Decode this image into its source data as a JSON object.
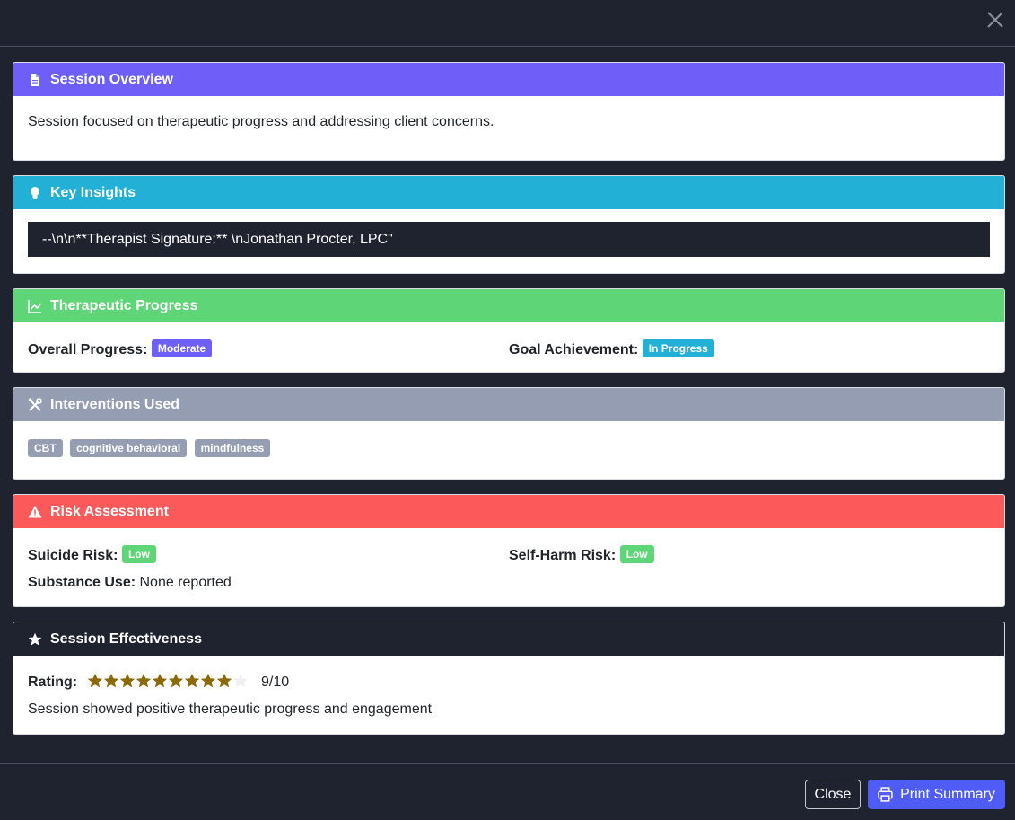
{
  "colors": {
    "background": "#1f2330",
    "purple": "#6e5ff8",
    "cyan": "#22b0d6",
    "green": "#5ed577",
    "gray": "#949db1",
    "red": "#fc5a5a",
    "star_filled": "#8a6a08",
    "button_primary": "#4f5cf5"
  },
  "overview": {
    "title": "Session Overview",
    "icon": "document-icon",
    "text": "Session focused on therapeutic progress and addressing client concerns."
  },
  "insights": {
    "title": "Key Insights",
    "icon": "lightbulb-icon",
    "text": "--\\n\\n**Therapist Signature:** \\nJonathan Procter, LPC\""
  },
  "progress": {
    "title": "Therapeutic Progress",
    "icon": "chart-line-icon",
    "overall_label": "Overall Progress:",
    "overall_value": "Moderate",
    "goal_label": "Goal Achievement:",
    "goal_value": "In Progress"
  },
  "interventions": {
    "title": "Interventions Used",
    "icon": "tools-icon",
    "tags": [
      "CBT",
      "cognitive behavioral",
      "mindfulness"
    ]
  },
  "risk": {
    "title": "Risk Assessment",
    "icon": "warning-icon",
    "suicide_label": "Suicide Risk:",
    "suicide_value": "Low",
    "selfharm_label": "Self-Harm Risk:",
    "selfharm_value": "Low",
    "substance_label": "Substance Use:",
    "substance_value": "None reported"
  },
  "effectiveness": {
    "title": "Session Effectiveness",
    "icon": "star-icon",
    "rating_label": "Rating:",
    "rating_value": 9,
    "rating_max": 10,
    "rating_text": "9/10",
    "note": "Session showed positive therapeutic progress and engagement"
  },
  "footer": {
    "close_label": "Close",
    "print_label": "Print Summary"
  }
}
